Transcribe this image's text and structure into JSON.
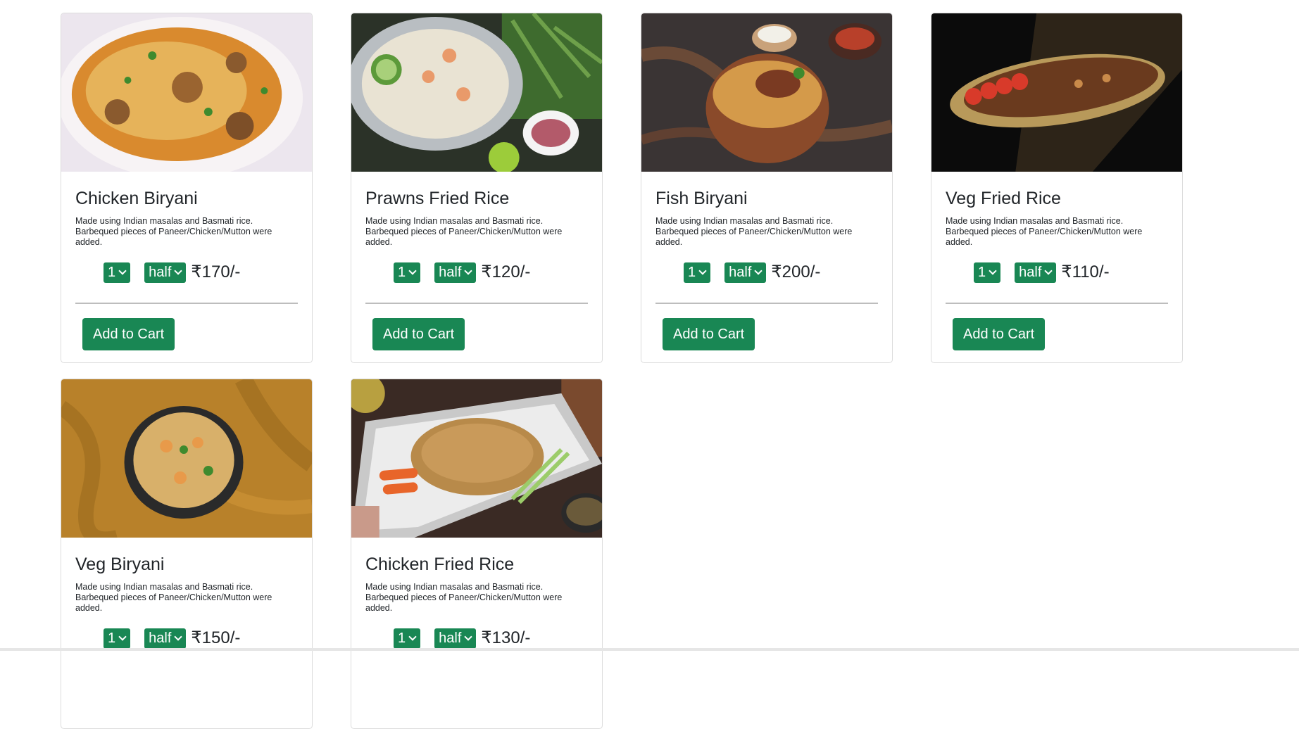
{
  "menu": {
    "items": [
      {
        "title": "Chicken Biryani",
        "description": "Made using Indian masalas and Basmati rice. Barbequed pieces of Paneer/Chicken/Mutton were added.",
        "quantity": "1",
        "size": "half",
        "price": "₹170/-",
        "add_label": "Add to Cart",
        "image": "chicken-biryani-photo"
      },
      {
        "title": "Prawns Fried Rice",
        "description": "Made using Indian masalas and Basmati rice. Barbequed pieces of Paneer/Chicken/Mutton were added.",
        "quantity": "1",
        "size": "half",
        "price": "₹120/-",
        "add_label": "Add to Cart",
        "image": "prawns-fried-rice-photo"
      },
      {
        "title": "Fish Biryani",
        "description": "Made using Indian masalas and Basmati rice. Barbequed pieces of Paneer/Chicken/Mutton were added.",
        "quantity": "1",
        "size": "half",
        "price": "₹200/-",
        "add_label": "Add to Cart",
        "image": "fish-biryani-photo"
      },
      {
        "title": "Veg Fried Rice",
        "description": "Made using Indian masalas and Basmati rice. Barbequed pieces of Paneer/Chicken/Mutton were added.",
        "quantity": "1",
        "size": "half",
        "price": "₹110/-",
        "add_label": "Add to Cart",
        "image": "veg-fried-rice-photo"
      },
      {
        "title": "Veg Biryani",
        "description": "Made using Indian masalas and Basmati rice. Barbequed pieces of Paneer/Chicken/Mutton were added.",
        "quantity": "1",
        "size": "half",
        "price": "₹150/-",
        "image": "veg-biryani-photo"
      },
      {
        "title": "Chicken Fried Rice",
        "description": "Made using Indian masalas and Basmati rice. Barbequed pieces of Paneer/Chicken/Mutton were added.",
        "quantity": "1",
        "size": "half",
        "price": "₹130/-",
        "image": "chicken-fried-rice-photo"
      }
    ]
  },
  "colors": {
    "accent": "#198754",
    "text": "#212529",
    "border": "#dcdcdc"
  }
}
